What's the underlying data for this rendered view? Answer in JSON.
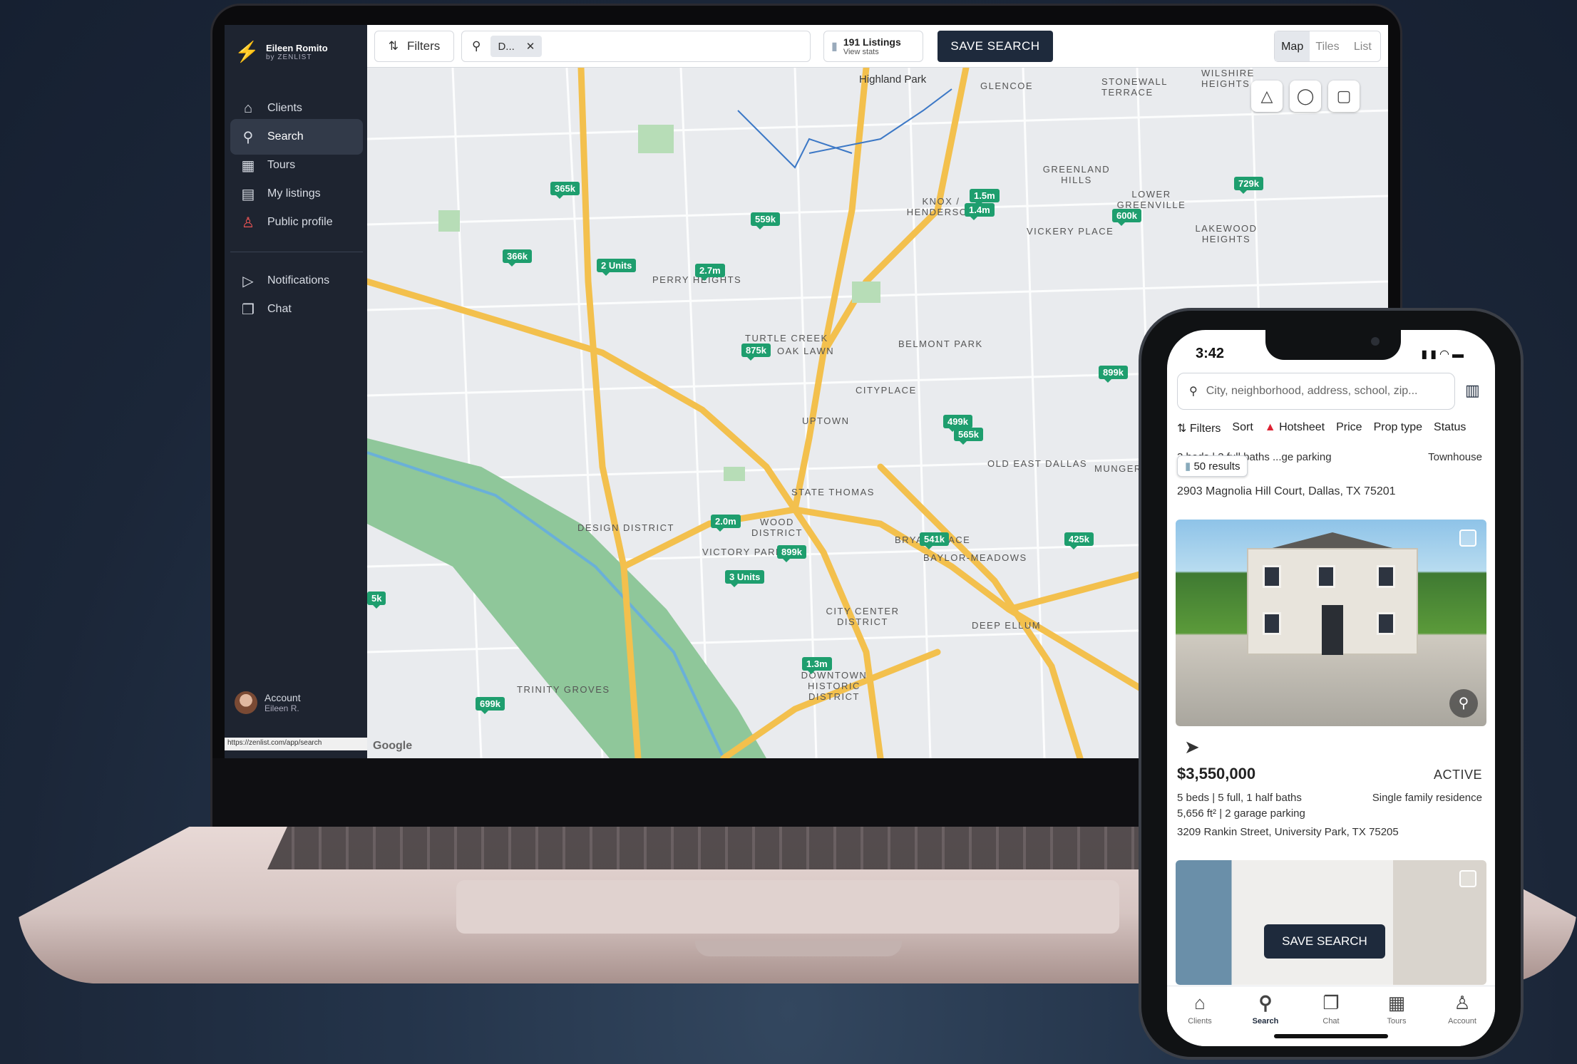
{
  "desktop": {
    "brand": {
      "name": "Eileen Romito",
      "sub": "by ZENLIST"
    },
    "nav": [
      {
        "label": "Clients",
        "icon": "home-icon"
      },
      {
        "label": "Search",
        "icon": "search-icon",
        "active": true
      },
      {
        "label": "Tours",
        "icon": "calendar-icon"
      },
      {
        "label": "My listings",
        "icon": "listings-icon"
      },
      {
        "label": "Public profile",
        "icon": "profile-icon"
      }
    ],
    "nav2": [
      {
        "label": "Notifications",
        "icon": "bell-icon"
      },
      {
        "label": "Chat",
        "icon": "chat-icon"
      }
    ],
    "account": {
      "label": "Account",
      "name": "Eileen R."
    },
    "status_url": "https://zenlist.com/app/search",
    "toolbar": {
      "filters_label": "Filters",
      "chip_label": "D...",
      "listings_count": "191 Listings",
      "listings_sub": "View stats",
      "save_label": "SAVE SEARCH",
      "views": [
        "Map",
        "Tiles",
        "List"
      ],
      "selected_view": "Map"
    },
    "map": {
      "attribution": "Google",
      "places": [
        "Highland Park",
        "GLENCOE",
        "STONEWALL TERRACE",
        "WILSHIRE HEIGHTS",
        "GREENLAND HILLS",
        "KNOX / HENDERSON",
        "LOWER GREENVILLE",
        "VICKERY PLACE",
        "LAKEWOOD HEIGHTS",
        "PERRY HEIGHTS",
        "TURTLE CREEK",
        "OAK LAWN",
        "BELMONT PARK",
        "CITYPLACE",
        "UPTOWN",
        "OLD EAST DALLAS",
        "MUNGER",
        "STATE THOMAS",
        "DESIGN DISTRICT",
        "WOOD DISTRICT",
        "VICTORY PARK",
        "BRYAN PLACE",
        "BAYLOR-MEADOWS",
        "CITY CENTER DISTRICT",
        "DEEP ELLUM",
        "DOWNTOWN HISTORIC DISTRICT",
        "TRINITY GROVES"
      ],
      "pins": [
        "365k",
        "559k",
        "366k",
        "2 Units",
        "2.7m",
        "1.5m",
        "1.4m",
        "600k",
        "729k",
        "875k",
        "899k",
        "499k",
        "565k",
        "2.0m",
        "899k",
        "3 Units",
        "541k",
        "425k",
        "1.3m",
        "699k",
        "5k"
      ]
    }
  },
  "mobile": {
    "time": "3:42",
    "search_placeholder": "City, neighborhood, address, school, zip...",
    "filters": [
      "Filters",
      "Sort",
      "Hotsheet",
      "Price",
      "Prop type",
      "Status"
    ],
    "partial_line": "3 beds | 3 full baths   ...ge parking",
    "partial_type": "Townhouse",
    "results_label": "50 results",
    "address_prev": "2903 Magnolia Hill Court, Dallas, TX 75201",
    "listing": {
      "price": "$3,550,000",
      "status": "ACTIVE",
      "beds_baths": "5 beds | 5 full, 1 half baths",
      "type": "Single family residence",
      "size": "5,656 ft² | 2 garage parking",
      "address": "3209 Rankin Street, University Park, TX 75205"
    },
    "save_label": "SAVE SEARCH",
    "tabs": [
      "Clients",
      "Search",
      "Chat",
      "Tours",
      "Account"
    ],
    "active_tab": "Search"
  }
}
